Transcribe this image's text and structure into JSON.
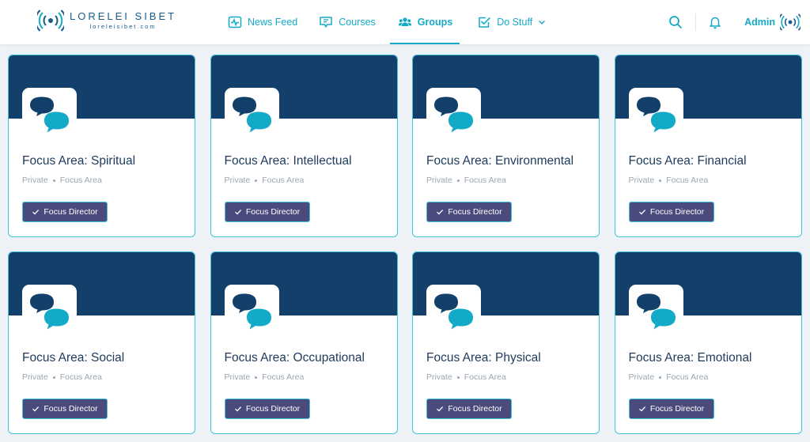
{
  "brand": {
    "name": "LORELEI SIBET",
    "domain": "loreleisibet.com",
    "primary_color": "#133f6b",
    "accent_color": "#13aac7"
  },
  "nav": {
    "items": [
      {
        "label": "News Feed",
        "icon": "pulse-icon",
        "active": false
      },
      {
        "label": "Courses",
        "icon": "courses-icon",
        "active": false
      },
      {
        "label": "Groups",
        "icon": "groups-icon",
        "active": true
      },
      {
        "label": "Do Stuff",
        "icon": "checkbox-icon",
        "active": false
      }
    ]
  },
  "user": {
    "name": "Admin"
  },
  "groups": [
    {
      "title": "Focus Area: Spiritual",
      "privacy": "Private",
      "type": "Focus Area",
      "role": "Focus Director"
    },
    {
      "title": "Focus Area: Intellectual",
      "privacy": "Private",
      "type": "Focus Area",
      "role": "Focus Director"
    },
    {
      "title": "Focus Area: Environmental",
      "privacy": "Private",
      "type": "Focus Area",
      "role": "Focus Director"
    },
    {
      "title": "Focus Area: Financial",
      "privacy": "Private",
      "type": "Focus Area",
      "role": "Focus Director"
    },
    {
      "title": "Focus Area: Social",
      "privacy": "Private",
      "type": "Focus Area",
      "role": "Focus Director"
    },
    {
      "title": "Focus Area: Occupational",
      "privacy": "Private",
      "type": "Focus Area",
      "role": "Focus Director"
    },
    {
      "title": "Focus Area: Physical",
      "privacy": "Private",
      "type": "Focus Area",
      "role": "Focus Director"
    },
    {
      "title": "Focus Area: Emotional",
      "privacy": "Private",
      "type": "Focus Area",
      "role": "Focus Director"
    }
  ]
}
